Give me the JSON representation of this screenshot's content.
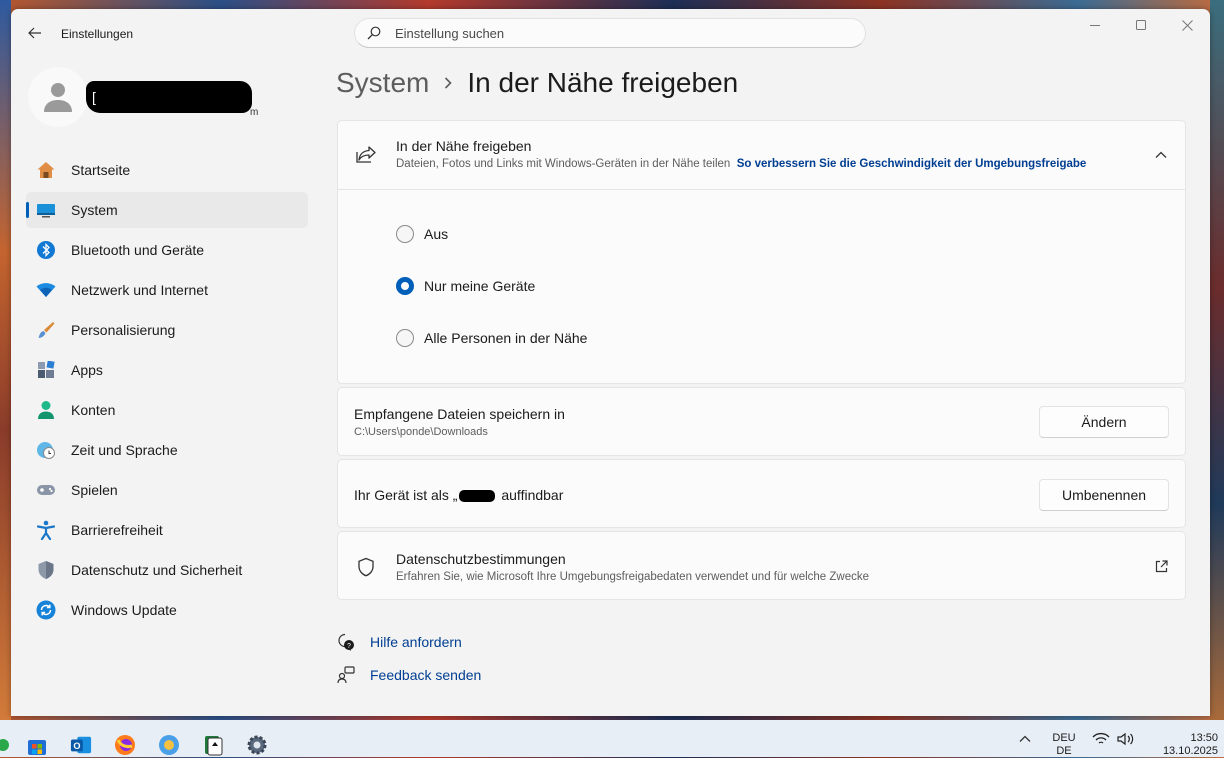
{
  "window": {
    "title": "Einstellungen",
    "controls": [
      "minimize",
      "maximize",
      "close"
    ]
  },
  "search": {
    "placeholder": "Einstellung suchen",
    "value": ""
  },
  "profile": {
    "name_visible": "[",
    "email_tail": "m"
  },
  "sidebar": {
    "items": [
      {
        "label": "Startseite",
        "icon": "home-icon",
        "active": false
      },
      {
        "label": "System",
        "icon": "display-icon",
        "active": true
      },
      {
        "label": "Bluetooth und Geräte",
        "icon": "bluetooth-icon",
        "active": false
      },
      {
        "label": "Netzwerk und Internet",
        "icon": "wifi-icon",
        "active": false
      },
      {
        "label": "Personalisierung",
        "icon": "brush-icon",
        "active": false
      },
      {
        "label": "Apps",
        "icon": "apps-icon",
        "active": false
      },
      {
        "label": "Konten",
        "icon": "account-icon",
        "active": false
      },
      {
        "label": "Zeit und Sprache",
        "icon": "clock-globe-icon",
        "active": false
      },
      {
        "label": "Spielen",
        "icon": "gamepad-icon",
        "active": false
      },
      {
        "label": "Barrierefreiheit",
        "icon": "accessibility-icon",
        "active": false
      },
      {
        "label": "Datenschutz und Sicherheit",
        "icon": "shield-icon",
        "active": false
      },
      {
        "label": "Windows Update",
        "icon": "update-icon",
        "active": false
      }
    ]
  },
  "breadcrumb": {
    "parent": "System",
    "current": "In der Nähe freigeben"
  },
  "nearby": {
    "title": "In der Nähe freigeben",
    "description": "Dateien, Fotos und Links mit Windows-Geräten in der Nähe teilen",
    "link": "So verbessern Sie die Geschwindigkeit der Umgebungsfreigabe",
    "options": [
      {
        "label": "Aus",
        "selected": false
      },
      {
        "label": "Nur meine Geräte",
        "selected": true
      },
      {
        "label": "Alle Personen in der Nähe",
        "selected": false
      }
    ]
  },
  "save_location": {
    "title": "Empfangene Dateien speichern in",
    "path": "C:\\Users\\ponde\\Downloads",
    "button": "Ändern"
  },
  "discoverable": {
    "prefix": "Ihr Gerät ist als „",
    "suffix": " auffindbar",
    "button": "Umbenennen"
  },
  "privacy": {
    "title": "Datenschutzbestimmungen",
    "description": "Erfahren Sie, wie Microsoft Ihre Umgebungsfreigabedaten verwendet und für welche Zwecke"
  },
  "help": {
    "get_help": "Hilfe anfordern",
    "feedback": "Feedback senden"
  },
  "taskbar": {
    "lang_top": "DEU",
    "lang_bottom": "DE",
    "time": "13:50",
    "date": "13.10.2025"
  },
  "colors": {
    "accent": "#005fb8",
    "link": "#003e92",
    "window_bg": "#f3f3f3",
    "card_bg": "#fbfbfb"
  }
}
